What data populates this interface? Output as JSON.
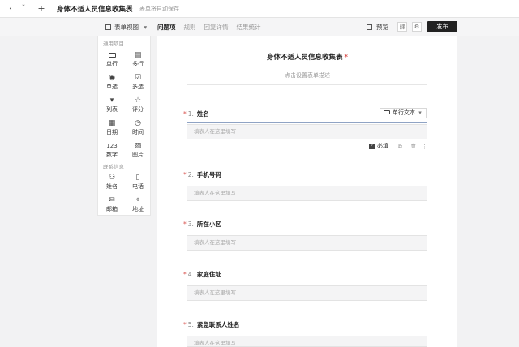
{
  "topbar": {
    "back": "‹",
    "dropdown": "˅",
    "add": "+",
    "title": "身体不适人员信息收集表",
    "autosave": "表单将自动保存"
  },
  "toolbar": {
    "view_label": "表单视图",
    "view_caret": "▾",
    "tabs": [
      "问题项",
      "规则",
      "回复详情",
      "结果统计"
    ],
    "preview": "预览",
    "link_icon": "⛓",
    "settings_icon": "⚙",
    "publish": "发布"
  },
  "palette": {
    "common_group": "通用项目",
    "contact_group": "联系信息",
    "items": [
      {
        "glyph": "▭",
        "label": "单行"
      },
      {
        "glyph": "▤",
        "label": "多行"
      },
      {
        "glyph": "◉",
        "label": "单选"
      },
      {
        "glyph": "☑",
        "label": "多选"
      },
      {
        "glyph": "▾",
        "label": "列表"
      },
      {
        "glyph": "☆",
        "label": "评分"
      },
      {
        "glyph": "▦",
        "label": "日期"
      },
      {
        "glyph": "◷",
        "label": "时间"
      },
      {
        "glyph": "123",
        "label": "数字"
      },
      {
        "glyph": "▨",
        "label": "图片"
      }
    ],
    "contact_items": [
      {
        "glyph": "⚇",
        "label": "姓名"
      },
      {
        "glyph": "▯",
        "label": "电话"
      },
      {
        "glyph": "✉",
        "label": "邮箱"
      },
      {
        "glyph": "⌖",
        "label": "地址"
      }
    ]
  },
  "form": {
    "title": "身体不适人员信息收集表",
    "required_mark": "*",
    "description_placeholder": "点击设置表单描述",
    "questions": [
      {
        "num": "1.",
        "text": "姓名",
        "placeholder": "填表人在这里填写"
      },
      {
        "num": "2.",
        "text": "手机号码",
        "placeholder": "填表人在这里填写"
      },
      {
        "num": "3.",
        "text": "所在小区",
        "placeholder": "填表人在这里填写"
      },
      {
        "num": "4.",
        "text": "家庭住址",
        "placeholder": "填表人在这里填写"
      },
      {
        "num": "5.",
        "text": "紧急联系人姓名",
        "placeholder": "填表人在这里填写"
      }
    ],
    "type_select": "单行文本",
    "type_caret": "▾",
    "required_label": "必填",
    "copy_icon": "⧉",
    "delete_icon": "🗑",
    "more_icon": "⋮"
  }
}
